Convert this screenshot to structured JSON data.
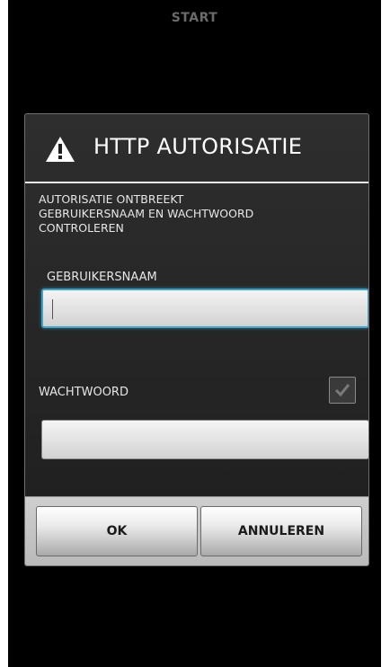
{
  "topbar": {
    "title": "START"
  },
  "dialog": {
    "title": "HTTP AUTORISATIE",
    "icon": "warning-icon",
    "message": "AUTORISATIE ONTBREEKT\nGEBRUIKERSNAAM EN WACHTWOORD\nCONTROLEREN",
    "username": {
      "label": "GEBRUIKERSNAAM",
      "value": "",
      "focused": true
    },
    "password": {
      "label": "WACHTWOORD",
      "value": "",
      "show_password_checked": true
    },
    "buttons": {
      "ok": "OK",
      "cancel": "ANNULEREN"
    }
  },
  "colors": {
    "focus_accent": "#3fa3c9",
    "dialog_bg": "#262626",
    "button_bar_bg": "#c4c4c4"
  }
}
